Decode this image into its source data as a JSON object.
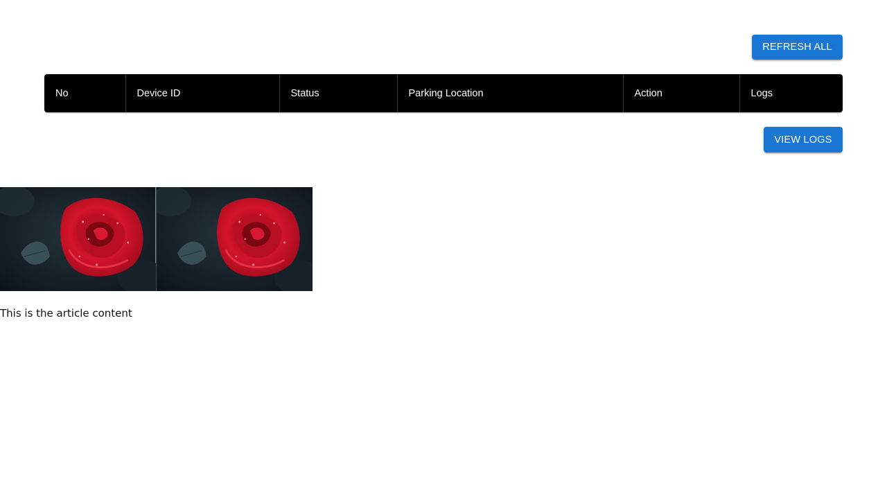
{
  "toolbar": {
    "refresh_label": "REFRESH ALL"
  },
  "table": {
    "columns": [
      "No",
      "Device ID",
      "Status",
      "Parking Location",
      "Action",
      "Logs"
    ]
  },
  "logs": {
    "view_label": "VIEW LOGS"
  },
  "images": [
    {
      "subject": "red rose with water droplets"
    },
    {
      "subject": "red rose with water droplets"
    }
  ],
  "article": {
    "text": "This is the article content"
  },
  "colors": {
    "primary_button": "#1976d2",
    "table_header_bg": "#000000",
    "table_header_text": "#ffffff"
  }
}
